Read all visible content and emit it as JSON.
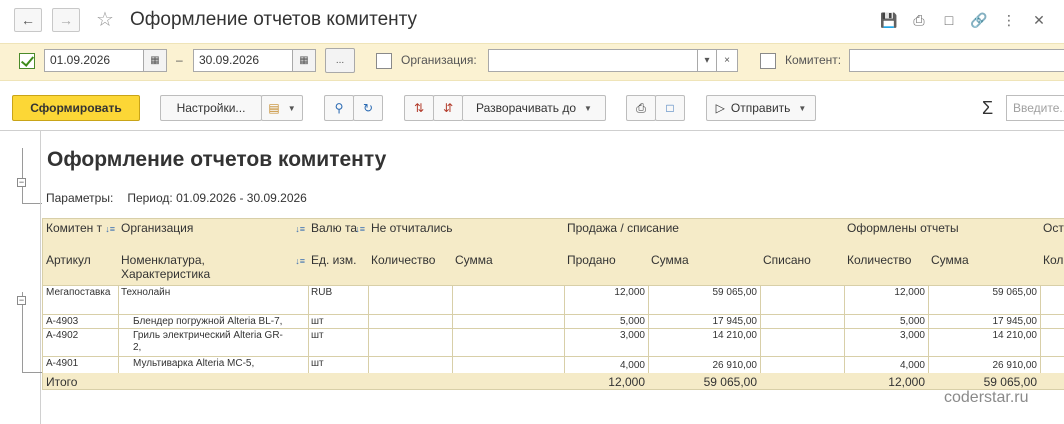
{
  "window": {
    "title": "Оформление отчетов комитенту"
  },
  "params": {
    "date_from": "01.09.2026",
    "date_sep": "–",
    "date_to": "30.09.2026",
    "more_label": "...",
    "org_label": "Организация:",
    "org_value": "",
    "clear_label": "×",
    "komitent_label": "Комитент:",
    "komitent_value": ""
  },
  "toolbar": {
    "form_label": "Сформировать",
    "settings_label": "Настройки...",
    "expand_label": "Разворачивать до",
    "send_label": "Отправить",
    "sigma": "Σ",
    "search_placeholder": "Введите..."
  },
  "report": {
    "title": "Оформление отчетов комитенту",
    "params_label": "Параметры:",
    "params_value": "Период: 01.09.2026 - 30.09.2026",
    "headers": {
      "komitent": "Комитен т",
      "organization": "Организация",
      "currency": "Валю та",
      "not_reported": "Не отчитались",
      "sale": "Продажа / списание",
      "reports_done": "Оформлены отчеты",
      "rest": "Ост",
      "article": "Артикул",
      "nomenclature": "Номенклатура, Характеристика",
      "unit": "Ед. изм.",
      "qty1": "Количество",
      "sum1": "Сумма",
      "sold": "Продано",
      "sum2": "Сумма",
      "written_off": "Списано",
      "qty3": "Количество",
      "sum3": "Сумма",
      "col_rest": "Кол"
    },
    "group_row": {
      "komitent": "Мегапоставка",
      "organization": "Технолайн",
      "currency": "RUB",
      "sold": "12,000",
      "sum_sale": "59 065,00",
      "qty_reports": "12,000",
      "sum_reports": "59 065,00"
    },
    "rows": [
      {
        "article": "А-4903",
        "name": "Блендер погружной Alteria BL-7,",
        "unit": "шт",
        "sold": "5,000",
        "sum_sale": "17 945,00",
        "qty_reports": "5,000",
        "sum_reports": "17 945,00"
      },
      {
        "article": "А-4902",
        "name": "Гриль электрический Alteria GR-2,",
        "unit": "шт",
        "sold": "3,000",
        "sum_sale": "14 210,00",
        "qty_reports": "3,000",
        "sum_reports": "14 210,00"
      },
      {
        "article": "А-4901",
        "name": "Мультиварка Alteria MC-5,",
        "unit": "шт",
        "sold": "4,000",
        "sum_sale": "26 910,00",
        "qty_reports": "4,000",
        "sum_reports": "26 910,00"
      }
    ],
    "total": {
      "label": "Итого",
      "sold": "12,000",
      "sum_sale": "59 065,00",
      "qty_reports": "12,000",
      "sum_reports": "59 065,00"
    }
  },
  "watermark": "coderstar.ru"
}
